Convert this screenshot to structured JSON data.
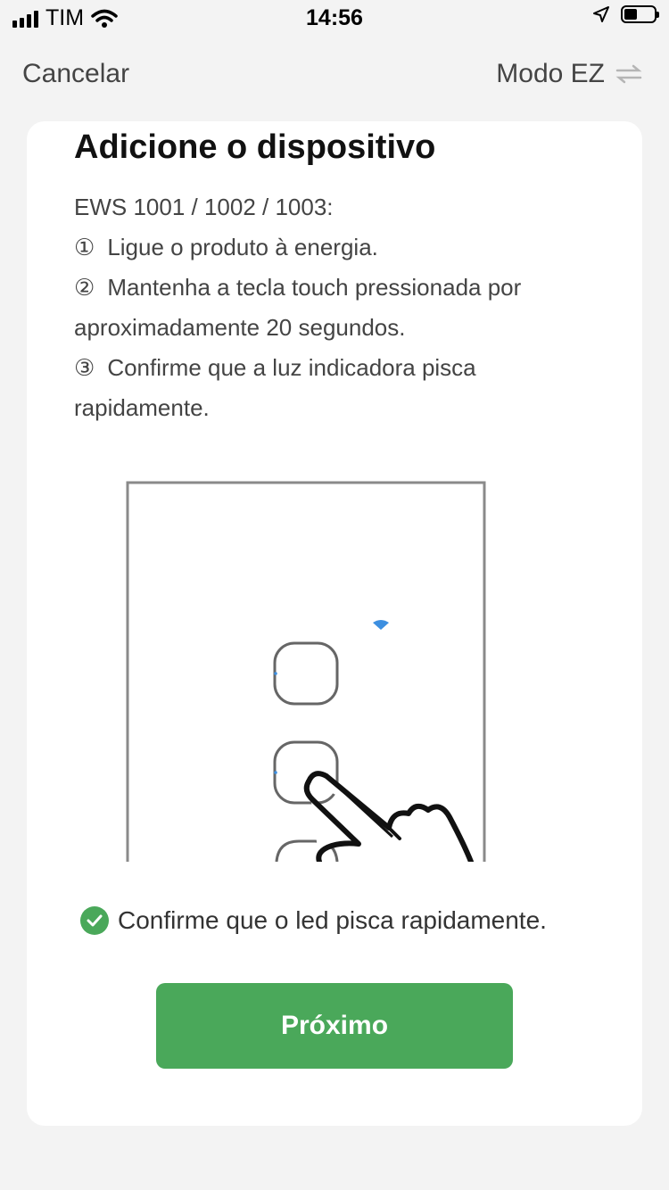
{
  "status_bar": {
    "carrier": "TIM",
    "time": "14:56",
    "icons": [
      "signal-icon",
      "wifi-icon",
      "location-icon",
      "battery-icon"
    ]
  },
  "nav": {
    "cancel_label": "Cancelar",
    "mode_label": "Modo EZ",
    "mode_icon": "swap-arrows-icon"
  },
  "card": {
    "title": "Adicione o dispositivo",
    "model_line": "EWS 1001 / 1002 / 1003:",
    "steps": [
      {
        "marker": "①",
        "text": "Ligue o produto à energia."
      },
      {
        "marker": "②",
        "text": "Mantenha a tecla touch pressionada por",
        "text_cont": "aproximadamente 20 segundos."
      },
      {
        "marker": "③",
        "text": "Confirme que a luz indicadora pisca",
        "text_cont": "rapidamente."
      }
    ],
    "illustration_icon": "touch-switch-hand-illustration"
  },
  "confirm": {
    "checked": true,
    "text": "Confirme que o led pisca rapidamente."
  },
  "next_button": {
    "label": "Próximo"
  },
  "colors": {
    "accent": "#4aa85a",
    "background": "#f3f3f3",
    "card": "#ffffff",
    "wifi_indicator": "#3d8fe0"
  }
}
